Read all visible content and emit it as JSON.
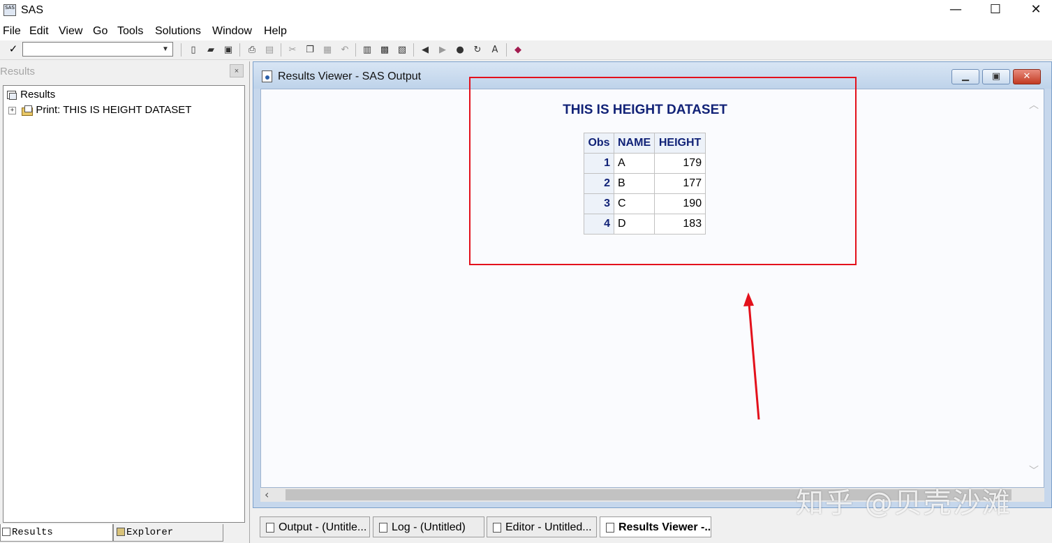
{
  "window": {
    "app_icon_text": "SAS",
    "title": "SAS",
    "minimize": "—",
    "maximize": "☐",
    "close": "✕"
  },
  "menu": [
    "File",
    "Edit",
    "View",
    "Go",
    "Tools",
    "Solutions",
    "Window",
    "Help"
  ],
  "toolbar": {
    "command_value": "",
    "check_icon": "✓"
  },
  "results_pane": {
    "header": "Results",
    "close": "×",
    "tree": {
      "root": "Results",
      "item": "Print:  THIS IS HEIGHT DATASET"
    },
    "tabs": [
      "Results",
      "Explorer"
    ]
  },
  "viewer": {
    "title": "Results Viewer - SAS Output",
    "output_title": "THIS IS HEIGHT DATASET",
    "columns": [
      "Obs",
      "NAME",
      "HEIGHT"
    ],
    "rows": [
      {
        "obs": "1",
        "name": "A",
        "height": "179"
      },
      {
        "obs": "2",
        "name": "B",
        "height": "177"
      },
      {
        "obs": "3",
        "name": "C",
        "height": "190"
      },
      {
        "obs": "4",
        "name": "D",
        "height": "183"
      }
    ]
  },
  "window_tabs": [
    "Output - (Untitle...",
    "Log - (Untitled)",
    "Editor - Untitled...",
    "Results Viewer -..."
  ],
  "watermark": "知乎 @贝壳沙滩",
  "colors": {
    "annotation_red": "#e3111c",
    "sas_title_blue": "#112277"
  }
}
